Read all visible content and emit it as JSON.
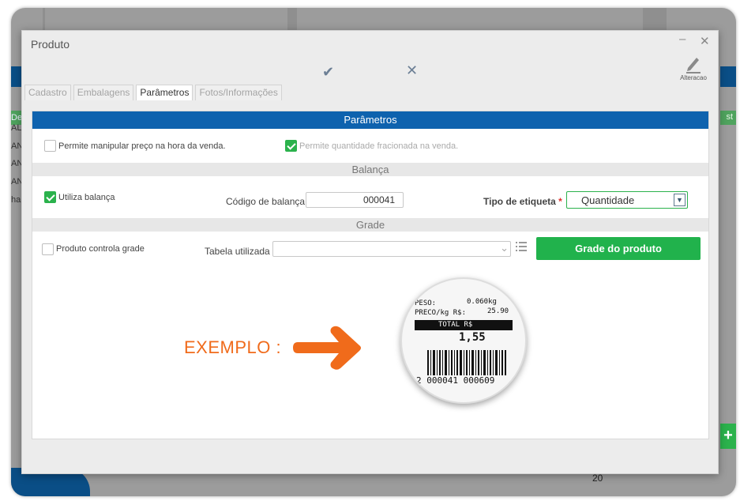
{
  "background": {
    "left_rows": [
      "Des",
      "AL",
      "AN",
      "AN",
      "AN",
      "har"
    ],
    "right_header": "st",
    "page_number": "20"
  },
  "window": {
    "title": "Produto",
    "minimize_icon": "minimize-icon",
    "close_icon": "close-icon"
  },
  "toolbar": {
    "confirm_icon": "check-icon",
    "cancel_icon": "x-icon",
    "edit_label": "Alteracao"
  },
  "tabs": [
    {
      "label": "Cadastro",
      "active": false
    },
    {
      "label": "Embalagens",
      "active": false
    },
    {
      "label": "Parâmetros",
      "active": true
    },
    {
      "label": "Fotos/Informações",
      "active": false
    }
  ],
  "parametros": {
    "title": "Parâmetros",
    "permite_manipular_preco": {
      "label": "Permite manipular preço na hora da venda.",
      "checked": false
    },
    "permite_quantidade_fracionada": {
      "label": "Permite quantidade fracionada na venda.",
      "checked": true
    }
  },
  "balanca": {
    "title": "Balança",
    "utiliza_balanca": {
      "label": "Utiliza balança",
      "checked": true
    },
    "codigo_label": "Código de balança",
    "codigo_value": "000041",
    "tipo_etiqueta_label": "Tipo de etiqueta",
    "tipo_etiqueta_required": "*",
    "tipo_etiqueta_value": "Quantidade"
  },
  "grade": {
    "title": "Grade",
    "produto_controla_grade": {
      "label": "Produto controla grade",
      "checked": false
    },
    "tabela_label": "Tabela utilizada",
    "tabela_value": "",
    "grade_button": "Grade do produto"
  },
  "exemplo": {
    "label": "EXEMPLO :",
    "ticket": {
      "peso_label": "PESO:",
      "peso_value": "0.060kg",
      "preco_label": "PRECO/kg R$:",
      "preco_value": "25.90",
      "total_label": "TOTAL  R$",
      "total_value": "1,55",
      "barcode_digits": "2 000041 000609"
    }
  },
  "colors": {
    "header_blue": "#0e62ae",
    "accent_green": "#21b24c",
    "arrow_orange": "#f06b1b"
  }
}
